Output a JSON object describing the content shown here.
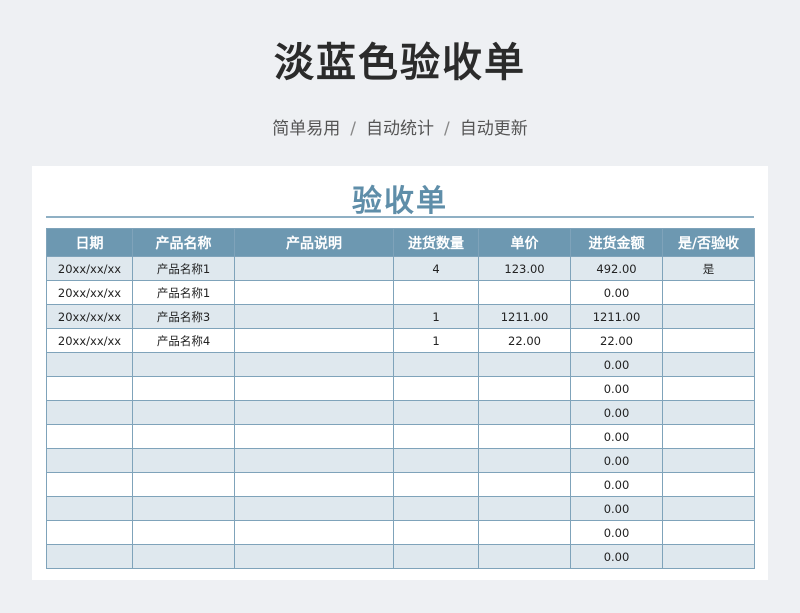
{
  "page": {
    "title": "淡蓝色验收单",
    "subtitle_parts": [
      "简单易用",
      "自动统计",
      "自动更新"
    ],
    "separator": "/"
  },
  "sheet": {
    "title": "验收单",
    "columns": [
      "日期",
      "产品名称",
      "产品说明",
      "进货数量",
      "单价",
      "进货金额",
      "是/否验收"
    ],
    "rows": [
      [
        "20xx/xx/xx",
        "产品名称1",
        "",
        "4",
        "123.00",
        "492.00",
        "是"
      ],
      [
        "20xx/xx/xx",
        "产品名称1",
        "",
        "",
        "",
        "0.00",
        ""
      ],
      [
        "20xx/xx/xx",
        "产品名称3",
        "",
        "1",
        "1211.00",
        "1211.00",
        ""
      ],
      [
        "20xx/xx/xx",
        "产品名称4",
        "",
        "1",
        "22.00",
        "22.00",
        ""
      ],
      [
        "",
        "",
        "",
        "",
        "",
        "0.00",
        ""
      ],
      [
        "",
        "",
        "",
        "",
        "",
        "0.00",
        ""
      ],
      [
        "",
        "",
        "",
        "",
        "",
        "0.00",
        ""
      ],
      [
        "",
        "",
        "",
        "",
        "",
        "0.00",
        ""
      ],
      [
        "",
        "",
        "",
        "",
        "",
        "0.00",
        ""
      ],
      [
        "",
        "",
        "",
        "",
        "",
        "0.00",
        ""
      ],
      [
        "",
        "",
        "",
        "",
        "",
        "0.00",
        ""
      ],
      [
        "",
        "",
        "",
        "",
        "",
        "0.00",
        ""
      ],
      [
        "",
        "",
        "",
        "",
        "",
        "0.00",
        ""
      ]
    ]
  },
  "colors": {
    "header_bg": "#6d98b1",
    "sheet_title": "#5f8ea9",
    "stripe": "#dfe8ee",
    "border": "#7fa3ba"
  }
}
